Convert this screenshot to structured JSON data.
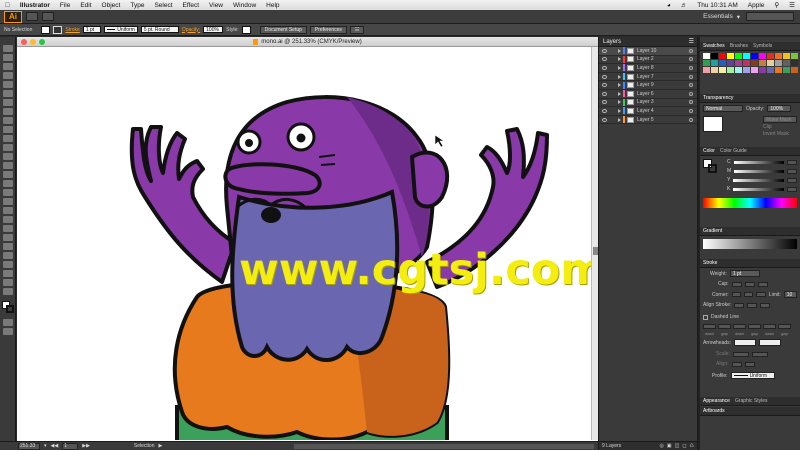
{
  "menubar": {
    "app_name": "Illustrator",
    "items": [
      "File",
      "Edit",
      "Object",
      "Type",
      "Select",
      "Effect",
      "View",
      "Window",
      "Help"
    ],
    "clock": "Thu 10:31 AM",
    "user": "Apple"
  },
  "appbar": {
    "logo": "Ai",
    "workspace": "Essentials"
  },
  "controlbar": {
    "selection_label": "No Selection",
    "stroke_label": "Stroke",
    "stroke_weight": "1 pt",
    "profile_value": "Uniform",
    "brush_value": "5 pt. Round",
    "opacity_label": "Opacity:",
    "opacity_value": "100%",
    "style_label": "Style:",
    "doc_setup_button": "Document Setup",
    "preferences_button": "Preferences"
  },
  "document": {
    "title": "mono.ai @ 251.33% (CMYK/Preview)",
    "watermark": "www.cgtsj.com"
  },
  "statusbar": {
    "zoom": "251.33",
    "artboard": "1",
    "tool": "Selection"
  },
  "layers_panel": {
    "tab": "Layers",
    "layers": [
      {
        "name": "Layer 10",
        "color": "#4f7bff"
      },
      {
        "name": "Layer 2",
        "color": "#ff3a3a"
      },
      {
        "name": "Layer 8",
        "color": "#a06bff"
      },
      {
        "name": "Layer 7",
        "color": "#32c8ff"
      },
      {
        "name": "Layer 9",
        "color": "#3a8bff"
      },
      {
        "name": "Layer 6",
        "color": "#ff5aa0"
      },
      {
        "name": "Layer 3",
        "color": "#30d060"
      },
      {
        "name": "Layer 4",
        "color": "#3aa0ff"
      },
      {
        "name": "Layer 5",
        "color": "#ff9a30"
      }
    ],
    "footer": "9 Layers"
  },
  "right_panel": {
    "swatches_tabs": [
      "Swatches",
      "Brushes",
      "Symbols"
    ],
    "transparency_tab": "Transparency",
    "blend_mode": "Normal",
    "opacity_label": "Opacity:",
    "opacity_value": "100%",
    "make_mask": "Make Mask",
    "clip_label": "Clip",
    "invert_mask": "Invert Mask",
    "color_tabs": [
      "Color",
      "Color Guide"
    ],
    "cmyk_labels": [
      "C",
      "M",
      "Y",
      "K"
    ],
    "gradient_tab": "Gradient",
    "stroke_tab": "Stroke",
    "weight_label": "Weight:",
    "weight_value": "1 pt",
    "cap_label": "Cap:",
    "corner_label": "Corner:",
    "limit_label": "Limit:",
    "limit_value": "10",
    "align_label": "Align Stroke:",
    "dashed_label": "Dashed Line",
    "dash_labels": [
      "dash",
      "gap",
      "dash",
      "gap",
      "dash",
      "gap"
    ],
    "arrowheads_label": "Arrowheads:",
    "scale_label": "Scale:",
    "align2_label": "Align:",
    "profile_label": "Profile:",
    "profile_value": "Uniform",
    "bottom_tabs": [
      "Appearance",
      "Graphic Styles"
    ],
    "artboards_tab": "Artboards"
  },
  "colors": {
    "accent_orange": "#ff9a00",
    "character_purple": "#8a3aa8",
    "beard_blue": "#6a66b0",
    "fur_orange": "#e87a1e",
    "pants_green": "#3aa05a"
  }
}
